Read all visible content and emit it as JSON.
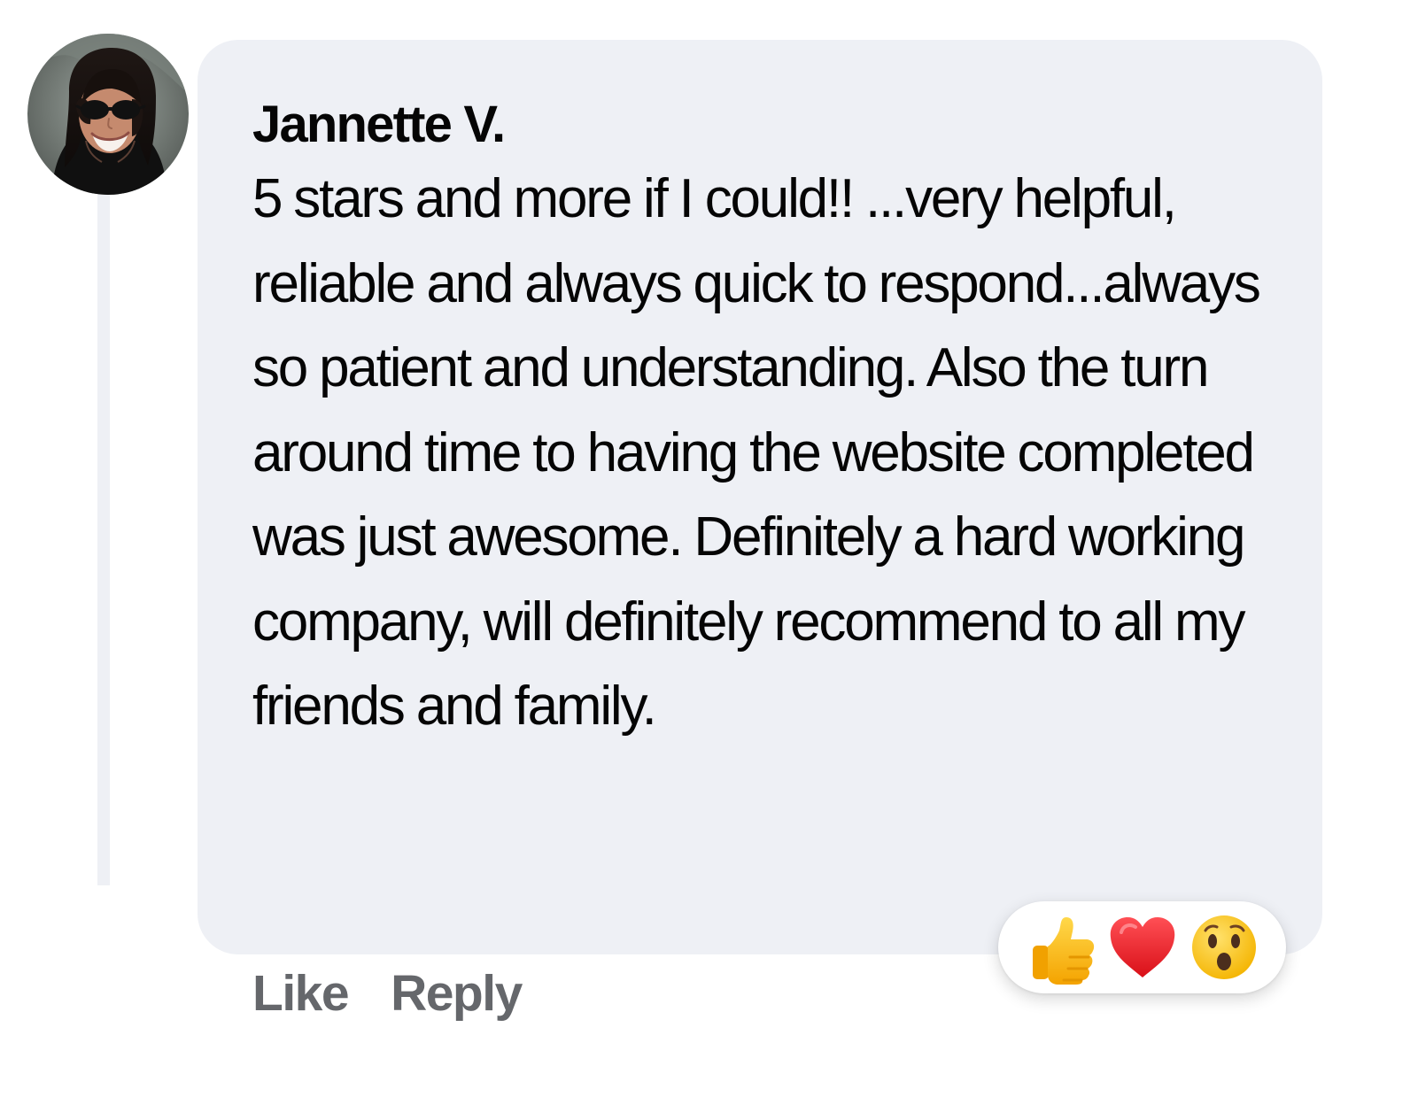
{
  "comment": {
    "author_name": "Jannette V.",
    "text": "5 stars and more if I could!! ...very helpful, reliable and always quick to respond...always so patient and understanding. Also the turn around time to having the website completed was just awesome. Definitely a hard working company, will definitely recommend to all my friends and family."
  },
  "actions": {
    "like_label": "Like",
    "reply_label": "Reply"
  },
  "reactions": {
    "icons": [
      "thumbs-up-icon",
      "heart-icon",
      "surprised-face-icon"
    ]
  },
  "colors": {
    "bubble_background": "#eef0f5",
    "author_text": "#050505",
    "action_text": "#65676b",
    "thread_line": "#eef0f5",
    "reaction_background": "#ffffff"
  }
}
